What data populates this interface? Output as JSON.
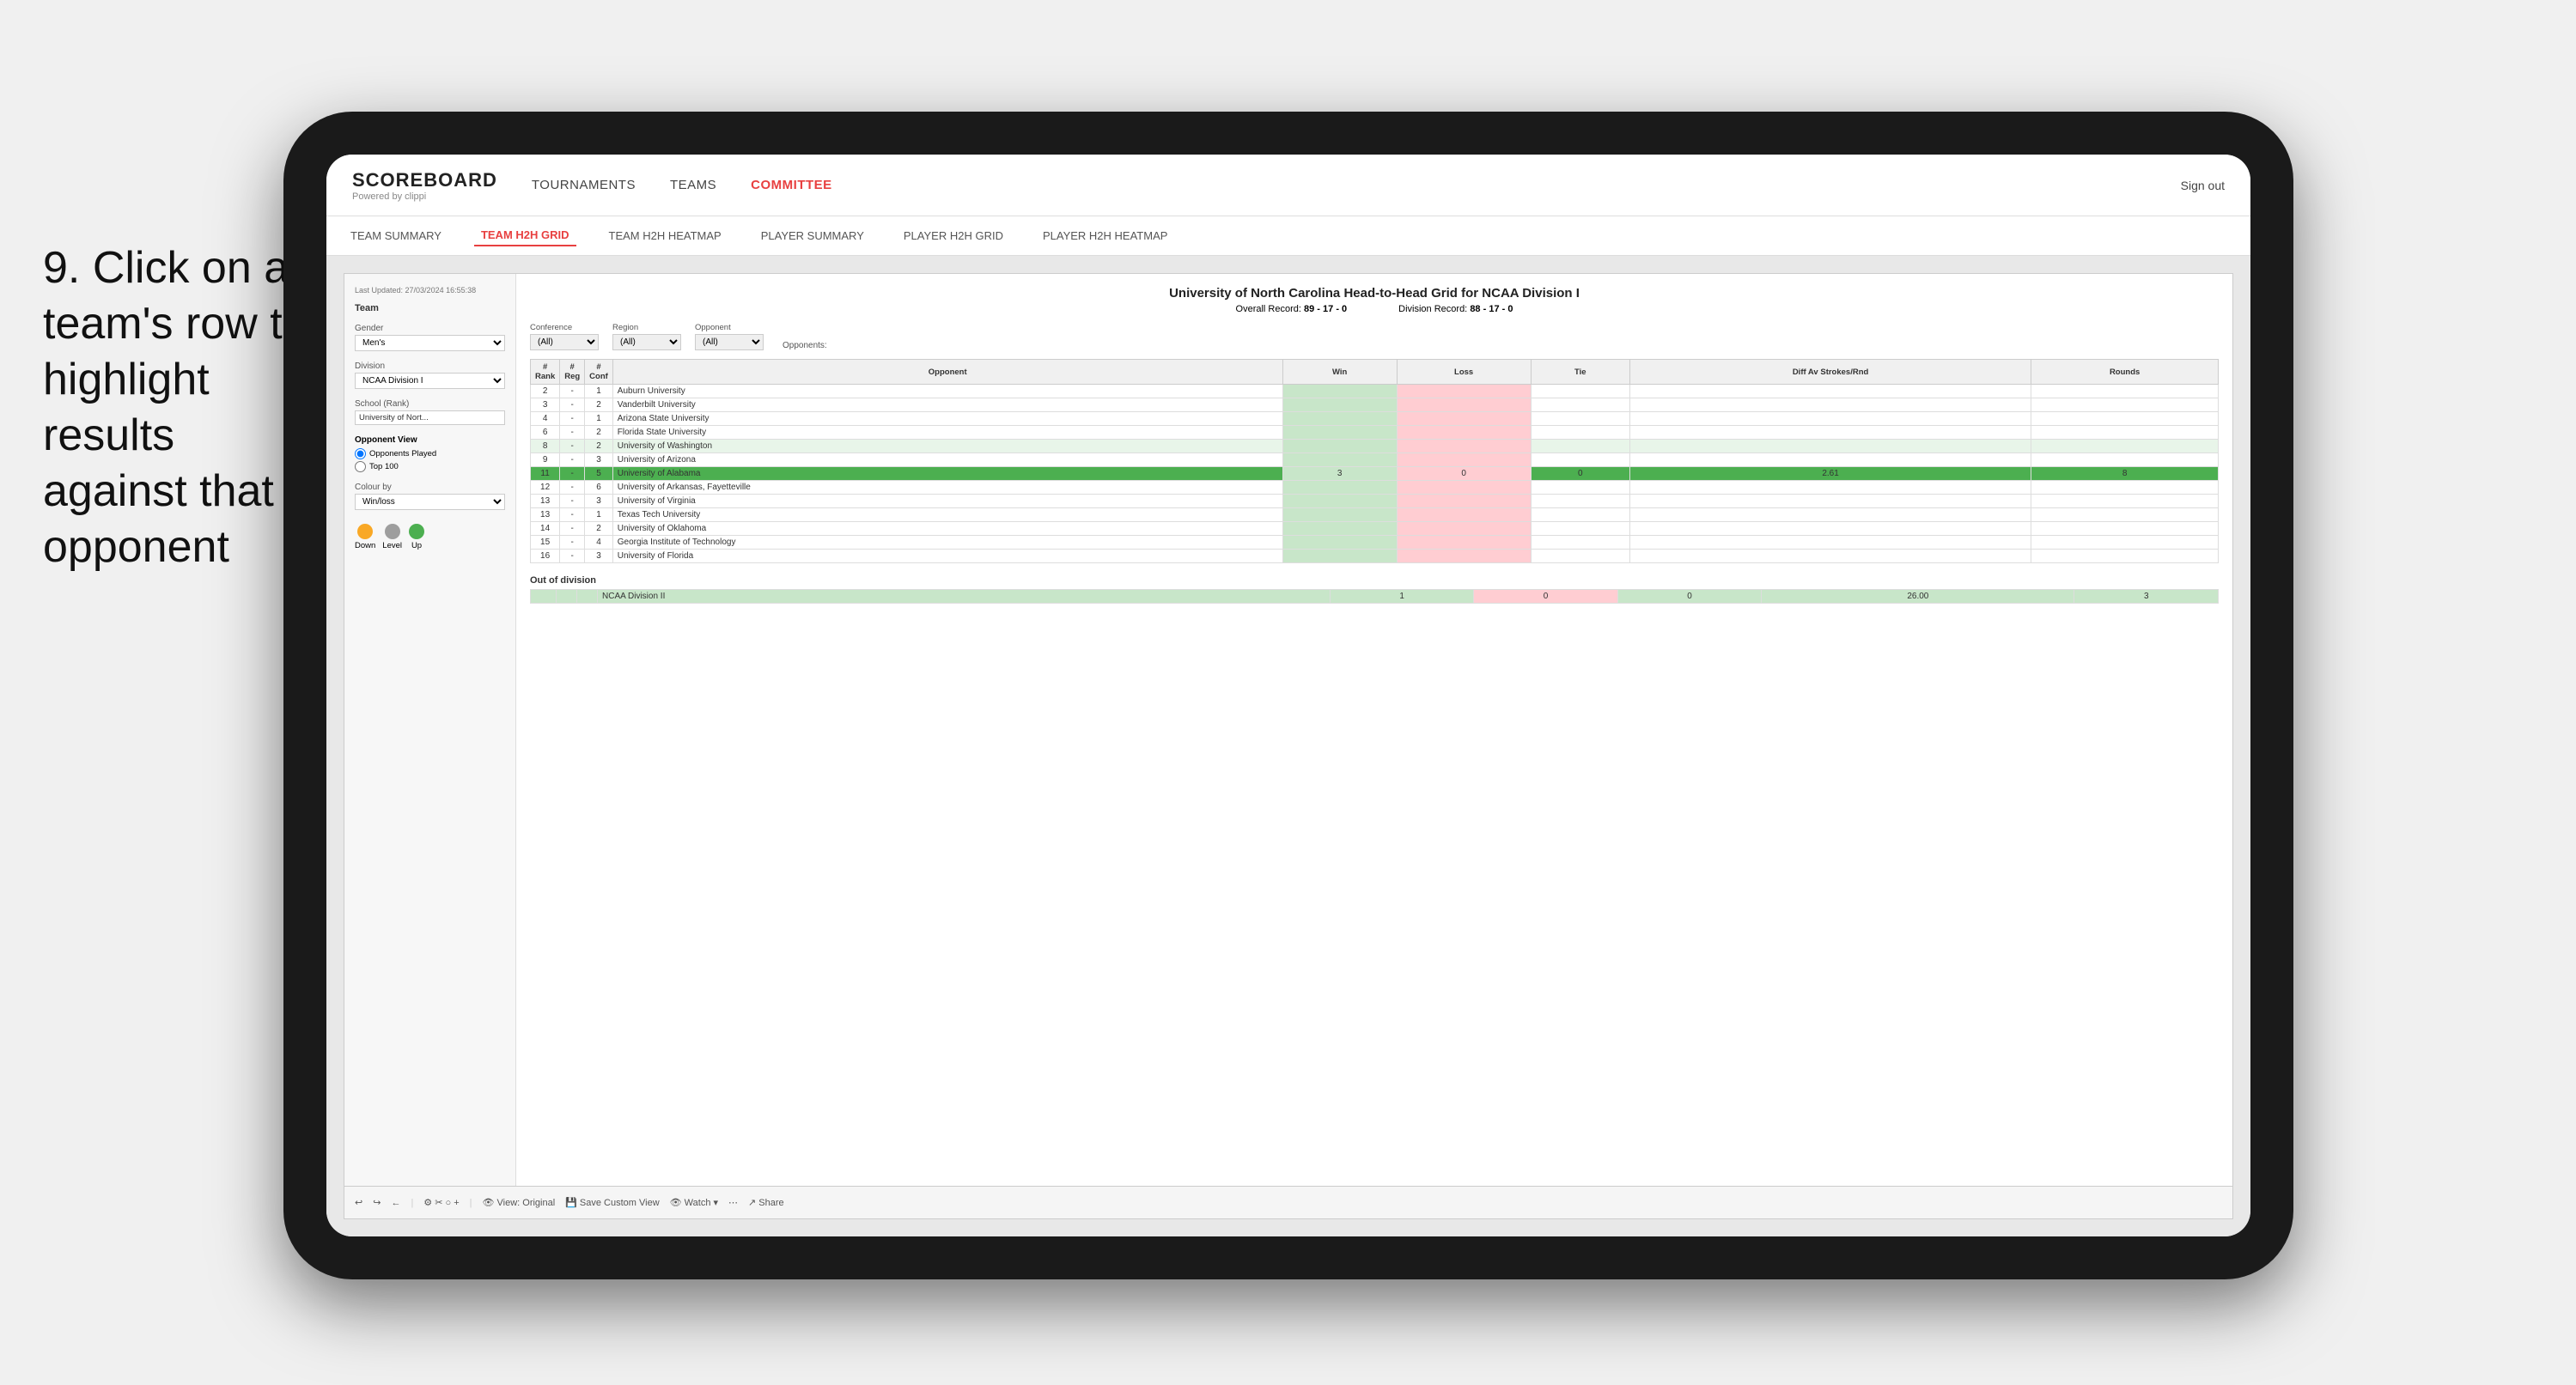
{
  "instruction": {
    "step": "9.",
    "text": "Click on a team's row to highlight results against that opponent"
  },
  "nav": {
    "logo_title": "SCOREBOARD",
    "logo_subtitle": "Powered by clippi",
    "items": [
      "TOURNAMENTS",
      "TEAMS",
      "COMMITTEE"
    ],
    "sign_out": "Sign out"
  },
  "sub_tabs": [
    "TEAM SUMMARY",
    "TEAM H2H GRID",
    "TEAM H2H HEATMAP",
    "PLAYER SUMMARY",
    "PLAYER H2H GRID",
    "PLAYER H2H HEATMAP"
  ],
  "active_sub_tab": "TEAM H2H GRID",
  "left_panel": {
    "last_updated": "Last Updated: 27/03/2024 16:55:38",
    "team_label": "Team",
    "gender_label": "Gender",
    "gender_value": "Men's",
    "division_label": "Division",
    "division_value": "NCAA Division I",
    "school_label": "School (Rank)",
    "school_value": "University of Nort...",
    "opponent_view_label": "Opponent View",
    "opponent_view_options": [
      "Opponents Played",
      "Top 100"
    ],
    "colour_by_label": "Colour by",
    "colour_by_value": "Win/loss",
    "legend": [
      {
        "label": "Down",
        "color": "#f9a825"
      },
      {
        "label": "Level",
        "color": "#9e9e9e"
      },
      {
        "label": "Up",
        "color": "#4caf50"
      }
    ]
  },
  "report": {
    "title": "University of North Carolina Head-to-Head Grid for NCAA Division I",
    "overall_record_label": "Overall Record:",
    "overall_record": "89 - 17 - 0",
    "division_record_label": "Division Record:",
    "division_record": "88 - 17 - 0",
    "filters": {
      "conference_label": "Conference",
      "conference_value": "(All)",
      "region_label": "Region",
      "region_value": "(All)",
      "opponent_label": "Opponent",
      "opponent_value": "(All)",
      "opponents_label": "Opponents:"
    },
    "table_headers": [
      "# Rank",
      "# Reg",
      "# Conf",
      "Opponent",
      "Win",
      "Loss",
      "Tie",
      "Diff Av Strokes/Rnd",
      "Rounds"
    ],
    "rows": [
      {
        "rank": "2",
        "reg": "-",
        "conf": "1",
        "opponent": "Auburn University",
        "win": "",
        "loss": "",
        "tie": "",
        "diff": "",
        "rounds": "",
        "style": "normal"
      },
      {
        "rank": "3",
        "reg": "-",
        "conf": "2",
        "opponent": "Vanderbilt University",
        "win": "",
        "loss": "",
        "tie": "",
        "diff": "",
        "rounds": "",
        "style": "normal"
      },
      {
        "rank": "4",
        "reg": "-",
        "conf": "1",
        "opponent": "Arizona State University",
        "win": "",
        "loss": "",
        "tie": "",
        "diff": "",
        "rounds": "",
        "style": "normal"
      },
      {
        "rank": "6",
        "reg": "-",
        "conf": "2",
        "opponent": "Florida State University",
        "win": "",
        "loss": "",
        "tie": "",
        "diff": "",
        "rounds": "",
        "style": "normal"
      },
      {
        "rank": "8",
        "reg": "-",
        "conf": "2",
        "opponent": "University of Washington",
        "win": "",
        "loss": "",
        "tie": "",
        "diff": "",
        "rounds": "",
        "style": "light-green"
      },
      {
        "rank": "9",
        "reg": "-",
        "conf": "3",
        "opponent": "University of Arizona",
        "win": "",
        "loss": "",
        "tie": "",
        "diff": "",
        "rounds": "",
        "style": "normal"
      },
      {
        "rank": "11",
        "reg": "-",
        "conf": "5",
        "opponent": "University of Alabama",
        "win": "3",
        "loss": "0",
        "tie": "0",
        "diff": "2.61",
        "rounds": "8",
        "style": "highlighted"
      },
      {
        "rank": "12",
        "reg": "-",
        "conf": "6",
        "opponent": "University of Arkansas, Fayetteville",
        "win": "",
        "loss": "",
        "tie": "",
        "diff": "",
        "rounds": "",
        "style": "normal"
      },
      {
        "rank": "13",
        "reg": "-",
        "conf": "3",
        "opponent": "University of Virginia",
        "win": "",
        "loss": "",
        "tie": "",
        "diff": "",
        "rounds": "",
        "style": "normal"
      },
      {
        "rank": "13",
        "reg": "-",
        "conf": "1",
        "opponent": "Texas Tech University",
        "win": "",
        "loss": "",
        "tie": "",
        "diff": "",
        "rounds": "",
        "style": "normal"
      },
      {
        "rank": "14",
        "reg": "-",
        "conf": "2",
        "opponent": "University of Oklahoma",
        "win": "",
        "loss": "",
        "tie": "",
        "diff": "",
        "rounds": "",
        "style": "normal"
      },
      {
        "rank": "15",
        "reg": "-",
        "conf": "4",
        "opponent": "Georgia Institute of Technology",
        "win": "",
        "loss": "",
        "tie": "",
        "diff": "",
        "rounds": "",
        "style": "normal"
      },
      {
        "rank": "16",
        "reg": "-",
        "conf": "3",
        "opponent": "University of Florida",
        "win": "",
        "loss": "",
        "tie": "",
        "diff": "",
        "rounds": "",
        "style": "normal"
      }
    ],
    "out_of_division_label": "Out of division",
    "out_of_division_row": {
      "label": "NCAA Division II",
      "win": "1",
      "loss": "0",
      "tie": "0",
      "diff": "26.00",
      "rounds": "3"
    }
  },
  "toolbar": {
    "undo": "↩",
    "redo": "↪",
    "back": "←",
    "view_original": "View: Original",
    "save_custom": "Save Custom View",
    "watch": "Watch ▾",
    "share": "Share"
  },
  "colors": {
    "accent_red": "#e84040",
    "green_highlight": "#4caf50",
    "light_green": "#c8e6c9",
    "light_red": "#ffcdd2",
    "yellow": "#f9a825",
    "gray": "#9e9e9e"
  }
}
